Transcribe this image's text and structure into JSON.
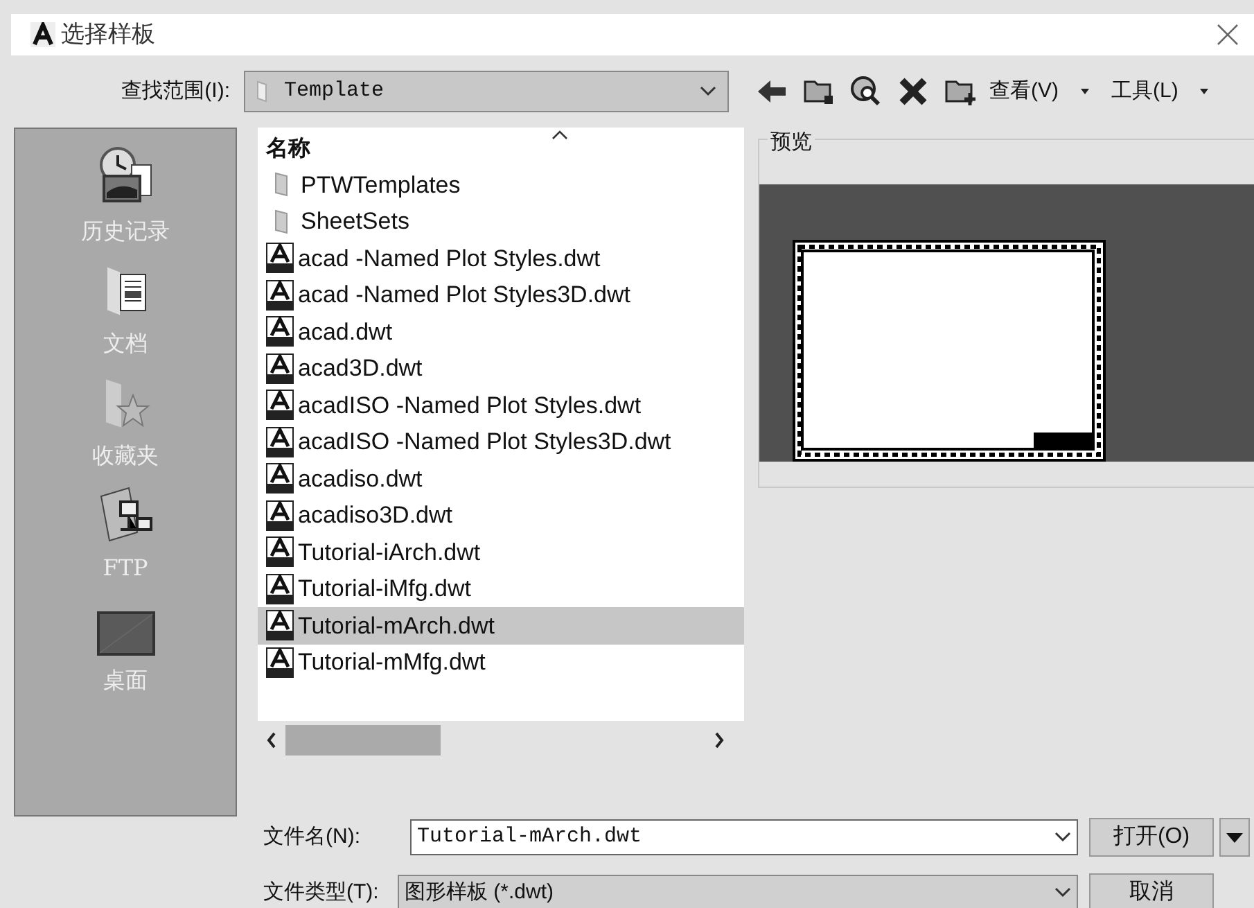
{
  "window": {
    "title": "选择样板"
  },
  "toolbar": {
    "look_in_label": "查找范围(I):",
    "look_in_value": "Template",
    "view_menu": "查看(V)",
    "tools_menu": "工具(L)"
  },
  "places": [
    {
      "label": "历史记录",
      "kind": "history"
    },
    {
      "label": "文档",
      "kind": "documents"
    },
    {
      "label": "收藏夹",
      "kind": "favorites"
    },
    {
      "label": "FTP",
      "kind": "ftp"
    },
    {
      "label": "桌面",
      "kind": "desktop"
    }
  ],
  "file_list": {
    "column": "名称",
    "items": [
      {
        "name": "PTWTemplates",
        "kind": "folder",
        "selected": false
      },
      {
        "name": "SheetSets",
        "kind": "folder",
        "selected": false
      },
      {
        "name": "acad -Named Plot Styles.dwt",
        "kind": "dwt",
        "selected": false
      },
      {
        "name": "acad -Named Plot Styles3D.dwt",
        "kind": "dwt",
        "selected": false
      },
      {
        "name": "acad.dwt",
        "kind": "dwt",
        "selected": false
      },
      {
        "name": "acad3D.dwt",
        "kind": "dwt",
        "selected": false
      },
      {
        "name": "acadISO -Named Plot Styles.dwt",
        "kind": "dwt",
        "selected": false
      },
      {
        "name": "acadISO -Named Plot Styles3D.dwt",
        "kind": "dwt",
        "selected": false
      },
      {
        "name": "acadiso.dwt",
        "kind": "dwt",
        "selected": false
      },
      {
        "name": "acadiso3D.dwt",
        "kind": "dwt",
        "selected": false
      },
      {
        "name": "Tutorial-iArch.dwt",
        "kind": "dwt",
        "selected": false
      },
      {
        "name": "Tutorial-iMfg.dwt",
        "kind": "dwt",
        "selected": false
      },
      {
        "name": "Tutorial-mArch.dwt",
        "kind": "dwt",
        "selected": true
      },
      {
        "name": "Tutorial-mMfg.dwt",
        "kind": "dwt",
        "selected": false
      }
    ]
  },
  "preview": {
    "label": "预览"
  },
  "file_name": {
    "label": "文件名(N):",
    "value": "Tutorial-mArch.dwt"
  },
  "file_type": {
    "label": "文件类型(T):",
    "value": "图形样板 (*.dwt)"
  },
  "buttons": {
    "open": "打开(O)",
    "cancel": "取消"
  }
}
